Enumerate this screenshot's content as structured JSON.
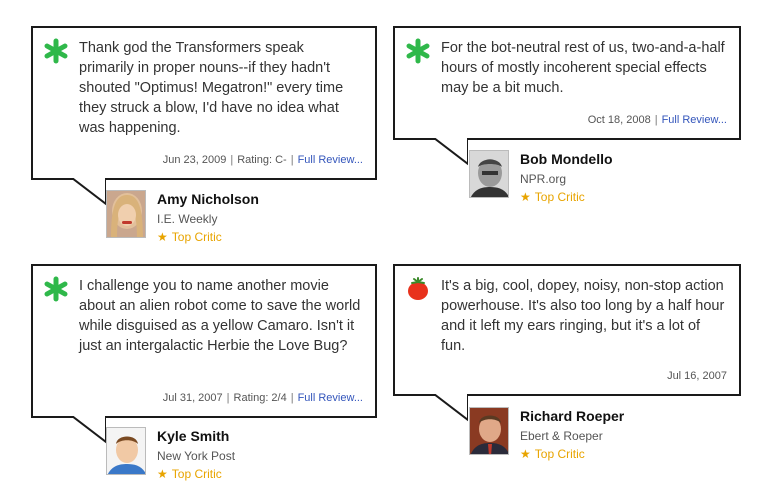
{
  "reviews": [
    {
      "quote": "Thank god the Transformers speak primarily in proper nouns--if they hadn't shouted \"Optimus! Megatron!\" every time they struck a blow, I'd have no idea what was happening.",
      "date": "Jun 23, 2009",
      "rating": "Rating: C-",
      "full_review": "Full Review...",
      "score_icon": "green-splat-icon",
      "critic": {
        "name": "Amy Nicholson",
        "publication": "I.E. Weekly",
        "top_critic": "Top Critic"
      }
    },
    {
      "quote": "For the bot-neutral rest of us, two-and-a-half hours of mostly incoherent special effects may be a bit much.",
      "date": "Oct 18, 2008",
      "full_review": "Full Review...",
      "score_icon": "green-splat-icon",
      "critic": {
        "name": "Bob Mondello",
        "publication": "NPR.org",
        "top_critic": "Top Critic"
      }
    },
    {
      "quote": "I challenge you to name another movie about an alien robot come to save the world while disguised as a yellow Camaro. Isn't it just an intergalactic Herbie the Love Bug?",
      "date": "Jul 31, 2007",
      "rating": "Rating: 2/4",
      "full_review": "Full Review...",
      "score_icon": "green-splat-icon",
      "critic": {
        "name": "Kyle Smith",
        "publication": "New York Post",
        "top_critic": "Top Critic"
      }
    },
    {
      "quote": "It's a big, cool, dopey, noisy, non-stop action powerhouse. It's also too long by a half hour and it left my ears ringing, but it's a lot of fun.",
      "date": "Jul 16, 2007",
      "score_icon": "fresh-tomato-icon",
      "critic": {
        "name": "Richard Roeper",
        "publication": "Ebert & Roeper",
        "top_critic": "Top Critic"
      }
    }
  ],
  "colors": {
    "splat": "#2fb84a",
    "tomato": "#e8321c",
    "top_critic": "#e8a400",
    "link": "#3355bb",
    "border": "#1a1a1a"
  }
}
